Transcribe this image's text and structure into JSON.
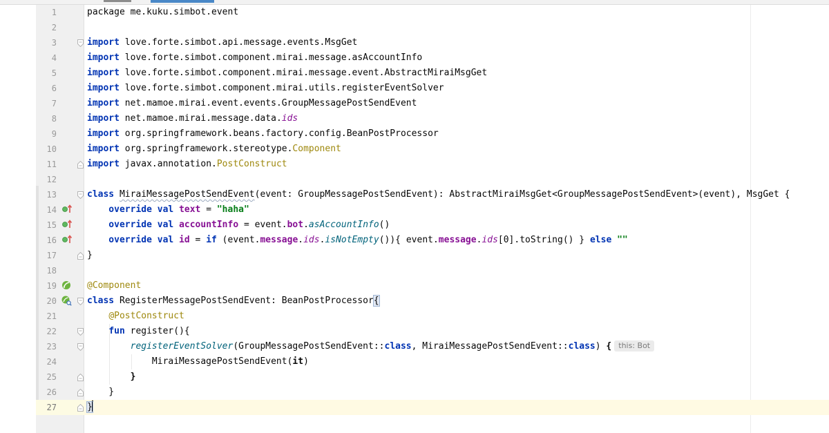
{
  "gutter_hints": {
    "overrides": "overrides member",
    "bean": "spring bean"
  },
  "lines": [
    {
      "n": "1",
      "segs": [
        {
          "t": "package",
          "c": ""
        },
        {
          "t": " me.kuku.simbot.event",
          "c": ""
        }
      ]
    },
    {
      "n": "2",
      "segs": []
    },
    {
      "n": "3",
      "segs": [
        {
          "t": "import",
          "c": "kw"
        },
        {
          "t": " love.forte.simbot.api.message.events.MsgGet",
          "c": ""
        }
      ]
    },
    {
      "n": "4",
      "segs": [
        {
          "t": "import",
          "c": "kw"
        },
        {
          "t": " love.forte.simbot.component.mirai.message.asAccountInfo",
          "c": ""
        }
      ]
    },
    {
      "n": "5",
      "segs": [
        {
          "t": "import",
          "c": "kw"
        },
        {
          "t": " love.forte.simbot.component.mirai.message.event.AbstractMiraiMsgGet",
          "c": ""
        }
      ]
    },
    {
      "n": "6",
      "segs": [
        {
          "t": "import",
          "c": "kw"
        },
        {
          "t": " love.forte.simbot.component.mirai.utils.registerEventSolver",
          "c": ""
        }
      ]
    },
    {
      "n": "7",
      "segs": [
        {
          "t": "import",
          "c": "kw"
        },
        {
          "t": " net.mamoe.mirai.event.events.GroupMessagePostSendEvent",
          "c": ""
        }
      ]
    },
    {
      "n": "8",
      "segs": [
        {
          "t": "import",
          "c": "kw"
        },
        {
          "t": " net.mamoe.mirai.message.data.",
          "c": ""
        },
        {
          "t": "ids",
          "c": "prop ital"
        }
      ]
    },
    {
      "n": "9",
      "segs": [
        {
          "t": "import",
          "c": "kw"
        },
        {
          "t": " org.springframework.beans.factory.config.BeanPostProcessor",
          "c": ""
        }
      ]
    },
    {
      "n": "10",
      "segs": [
        {
          "t": "import",
          "c": "kw"
        },
        {
          "t": " org.springframework.stereotype.",
          "c": ""
        },
        {
          "t": "Component",
          "c": "anno"
        }
      ]
    },
    {
      "n": "11",
      "segs": [
        {
          "t": "import",
          "c": "kw"
        },
        {
          "t": " javax.annotation.",
          "c": ""
        },
        {
          "t": "PostConstruct",
          "c": "anno"
        }
      ]
    },
    {
      "n": "12",
      "segs": []
    },
    {
      "n": "13",
      "segs": [
        {
          "t": "class",
          "c": "kw"
        },
        {
          "t": " ",
          "c": ""
        },
        {
          "t": "MiraiMessagePostSendEvent",
          "c": "squiggle"
        },
        {
          "t": "(event: GroupMessagePostSendEvent): AbstractMiraiMsgGet<GroupMessagePostSendEvent>(event), MsgGet {",
          "c": ""
        }
      ]
    },
    {
      "n": "14",
      "segs": [
        {
          "t": "    override val",
          "c": "kw"
        },
        {
          "t": " ",
          "c": ""
        },
        {
          "t": "text",
          "c": "dec"
        },
        {
          "t": " = ",
          "c": ""
        },
        {
          "t": "\"haha\"",
          "c": "str"
        }
      ]
    },
    {
      "n": "15",
      "segs": [
        {
          "t": "    override val",
          "c": "kw"
        },
        {
          "t": " ",
          "c": ""
        },
        {
          "t": "accountInfo",
          "c": "dec"
        },
        {
          "t": " = event.",
          "c": ""
        },
        {
          "t": "bot",
          "c": "prop bold"
        },
        {
          "t": ".",
          "c": ""
        },
        {
          "t": "asAccountInfo",
          "c": "ext"
        },
        {
          "t": "()",
          "c": ""
        }
      ]
    },
    {
      "n": "16",
      "segs": [
        {
          "t": "    override val",
          "c": "kw"
        },
        {
          "t": " ",
          "c": ""
        },
        {
          "t": "id",
          "c": "dec"
        },
        {
          "t": " = ",
          "c": ""
        },
        {
          "t": "if",
          "c": "kw"
        },
        {
          "t": " (event.",
          "c": ""
        },
        {
          "t": "message",
          "c": "prop bold"
        },
        {
          "t": ".",
          "c": ""
        },
        {
          "t": "ids",
          "c": "prop ital"
        },
        {
          "t": ".",
          "c": ""
        },
        {
          "t": "isNotEmpty",
          "c": "ext"
        },
        {
          "t": "()){ event.",
          "c": ""
        },
        {
          "t": "message",
          "c": "prop bold"
        },
        {
          "t": ".",
          "c": ""
        },
        {
          "t": "ids",
          "c": "prop ital"
        },
        {
          "t": "[0].toString() } ",
          "c": ""
        },
        {
          "t": "else",
          "c": "kw"
        },
        {
          "t": " ",
          "c": ""
        },
        {
          "t": "\"\"",
          "c": "str"
        }
      ]
    },
    {
      "n": "17",
      "segs": [
        {
          "t": "}",
          "c": ""
        }
      ]
    },
    {
      "n": "18",
      "segs": []
    },
    {
      "n": "19",
      "segs": [
        {
          "t": "@Component",
          "c": "anno"
        }
      ]
    },
    {
      "n": "20",
      "segs": [
        {
          "t": "class",
          "c": "kw"
        },
        {
          "t": " RegisterMessagePostSendEvent: BeanPostProcessor",
          "c": ""
        },
        {
          "t": "{",
          "c": "brace-match"
        }
      ]
    },
    {
      "n": "21",
      "segs": [
        {
          "t": "    ",
          "c": ""
        },
        {
          "t": "@PostConstruct",
          "c": "anno"
        }
      ]
    },
    {
      "n": "22",
      "segs": [
        {
          "t": "    ",
          "c": ""
        },
        {
          "t": "fun",
          "c": "kw"
        },
        {
          "t": " register(){",
          "c": ""
        }
      ]
    },
    {
      "n": "23",
      "segs": [
        {
          "t": "        ",
          "c": ""
        },
        {
          "t": "registerEventSolver",
          "c": "fn-italic"
        },
        {
          "t": "(GroupMessagePostSendEvent::",
          "c": ""
        },
        {
          "t": "class",
          "c": "kw"
        },
        {
          "t": ", MiraiMessagePostSendEvent::",
          "c": ""
        },
        {
          "t": "class",
          "c": "kw"
        },
        {
          "t": ") ",
          "c": ""
        },
        {
          "t": "{",
          "c": "bold"
        },
        {
          "t": "this: Bot",
          "c": "hint"
        }
      ]
    },
    {
      "n": "24",
      "segs": [
        {
          "t": "            MiraiMessagePostSendEvent(",
          "c": ""
        },
        {
          "t": "it",
          "c": "bold"
        },
        {
          "t": ")",
          "c": ""
        }
      ]
    },
    {
      "n": "25",
      "segs": [
        {
          "t": "        ",
          "c": ""
        },
        {
          "t": "}",
          "c": "bold"
        }
      ]
    },
    {
      "n": "26",
      "segs": [
        {
          "t": "    }",
          "c": ""
        }
      ]
    },
    {
      "n": "27",
      "segs": [
        {
          "t": "}",
          "c": "brace-match"
        }
      ]
    }
  ]
}
